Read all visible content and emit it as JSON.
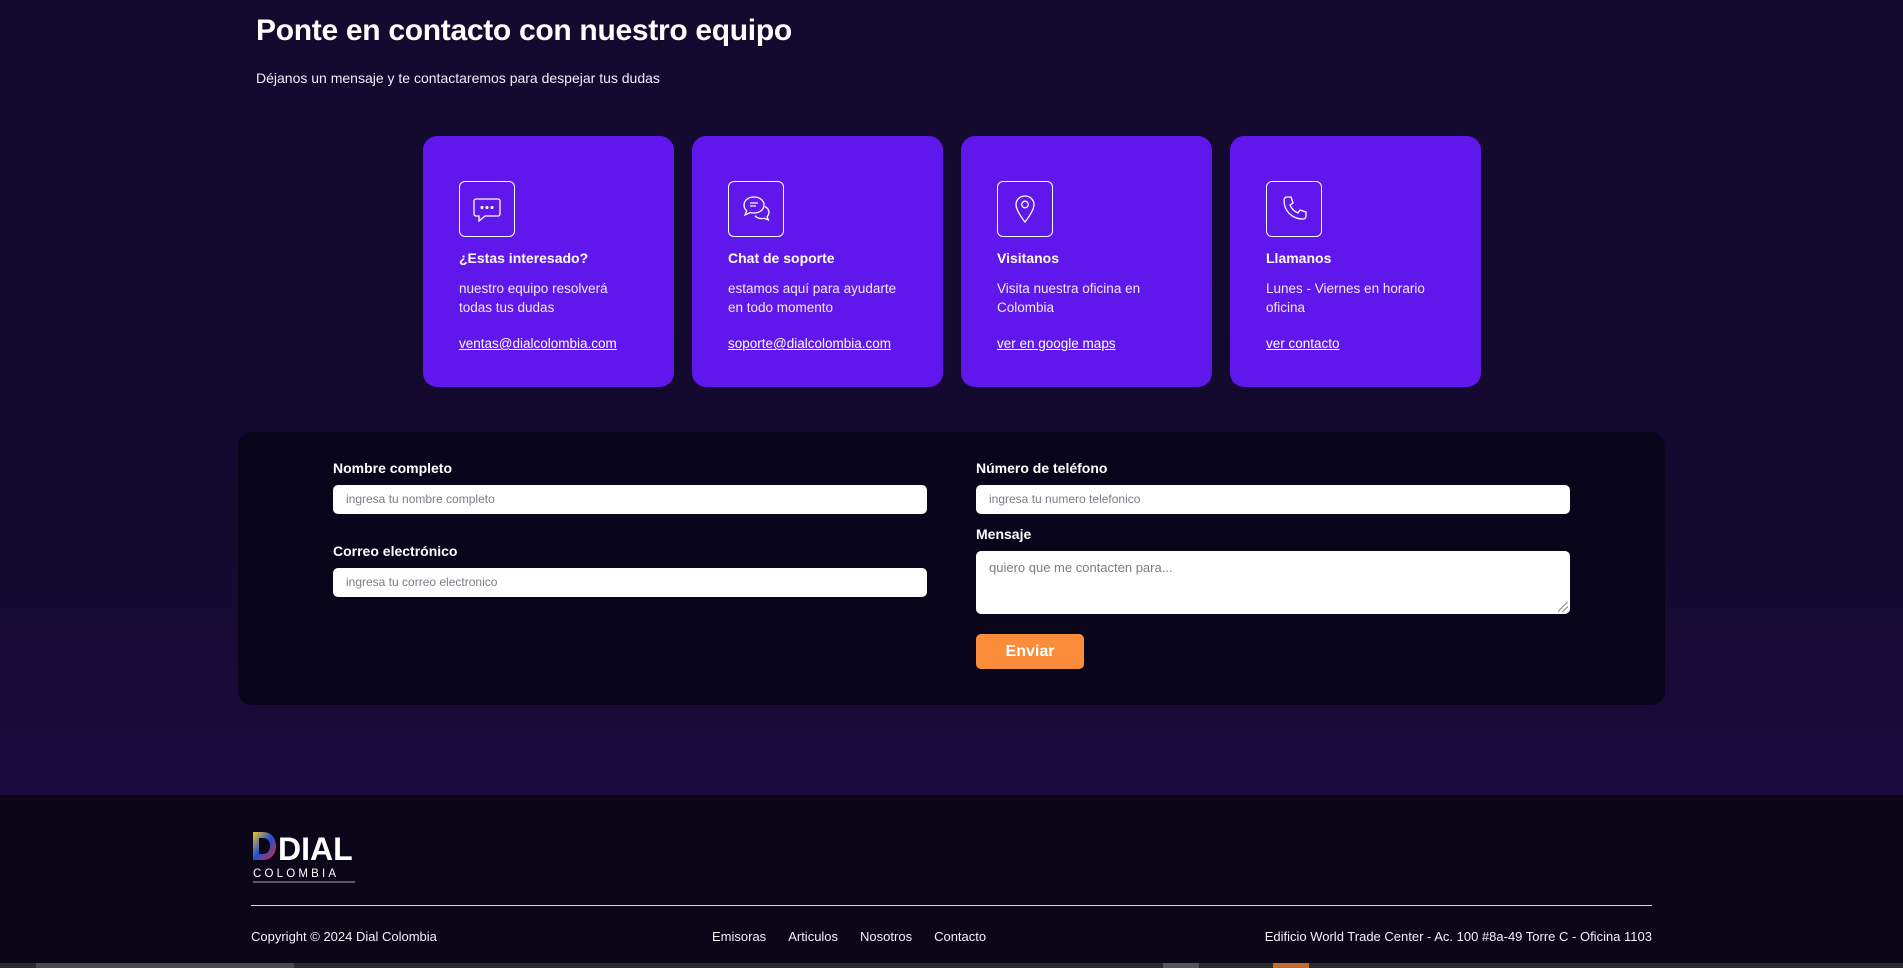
{
  "hero": {
    "title": "Ponte en contacto con nuestro equipo",
    "subtitle": "Déjanos un mensaje y te contactaremos para despejar tus dudas"
  },
  "cards": [
    {
      "icon": "chat-bubble-icon",
      "title": "¿Estas interesado?",
      "text": "nuestro equipo resolverá todas tus dudas",
      "link": "ventas@dialcolombia.com"
    },
    {
      "icon": "support-chat-icon",
      "title": "Chat de soporte",
      "text": "estamos aquí para ayudarte en todo momento",
      "link": "soporte@dialcolombia.com"
    },
    {
      "icon": "map-pin-icon",
      "title": "Visitanos",
      "text": "Visita nuestra oficina en Colombia",
      "link": "ver en google maps"
    },
    {
      "icon": "phone-icon",
      "title": "Llamanos",
      "text": "Lunes - Viernes en horario oficina",
      "link": "ver contacto"
    }
  ],
  "form": {
    "name": {
      "label": "Nombre completo",
      "placeholder": "ingresa tu nombre completo"
    },
    "email": {
      "label": "Correo electrónico",
      "placeholder": "ingresa tu correo electronico"
    },
    "phone": {
      "label": "Número de teléfono",
      "placeholder": "ingresa tu numero telefonico"
    },
    "message": {
      "label": "Mensaje",
      "placeholder": "quiero que me contacten para..."
    },
    "submit_label": "Enviar"
  },
  "footer": {
    "logo": {
      "text_top": "DIAL",
      "text_bottom": "COLOMBIA"
    },
    "copyright": "Copyright © 2024 Dial Colombia",
    "nav": [
      "Emisoras",
      "Articulos",
      "Nosotros",
      "Contacto"
    ],
    "address": "Edificio World Trade Center - Ac. 100 #8a-49 Torre C - Oficina 1103"
  },
  "colors": {
    "background": "#140a30",
    "card": "#5f17eb",
    "form_panel": "#09051a",
    "button": "#fb8d3a",
    "footer": "#0b0618"
  }
}
